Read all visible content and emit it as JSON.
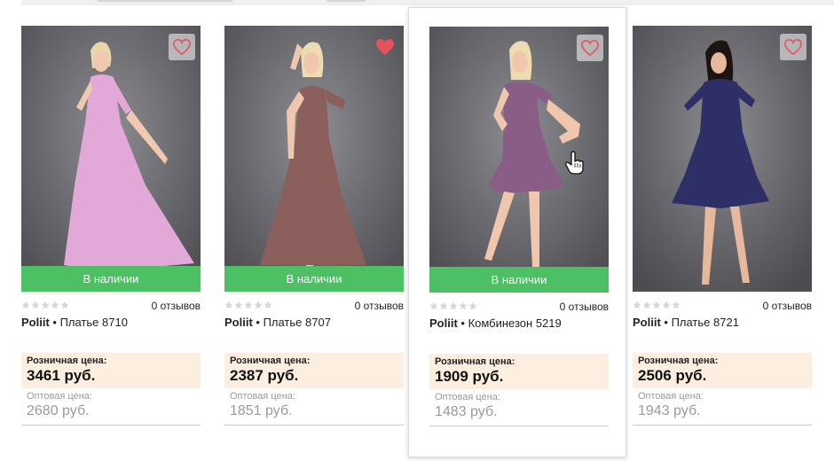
{
  "catalog": {
    "products": [
      {
        "brand": "Poliit",
        "name": "Платье 8710",
        "in_stock": "В наличии",
        "reviews": "0 отзывов",
        "retail_label": "Розничная цена:",
        "retail_price": "3461 руб.",
        "wholesale_label": "Оптовая цена:",
        "wholesale_price": "2680 руб.",
        "favorite": false,
        "dress_color": "#e2a9d8"
      },
      {
        "brand": "Poliit",
        "name": "Платье 8707",
        "in_stock": "В наличии",
        "reviews": "0 отзывов",
        "retail_label": "Розничная цена:",
        "retail_price": "2387 руб.",
        "wholesale_label": "Оптовая цена:",
        "wholesale_price": "1851 руб.",
        "favorite": true,
        "dress_color": "#8a5f5c"
      },
      {
        "brand": "Poliit",
        "name": "Комбинезон 5219",
        "in_stock": "В наличии",
        "reviews": "0 отзывов",
        "retail_label": "Розничная цена:",
        "retail_price": "1909 руб.",
        "wholesale_label": "Оптовая цена:",
        "wholesale_price": "1483 руб.",
        "favorite": false,
        "dress_color": "#8a5d86"
      },
      {
        "brand": "Poliit",
        "name": "Платье 8721",
        "in_stock": "",
        "reviews": "0 отзывов",
        "retail_label": "Розничная цена:",
        "retail_price": "2506 руб.",
        "wholesale_label": "Оптовая цена:",
        "wholesale_price": "1943 руб.",
        "favorite": false,
        "dress_color": "#2d2f66"
      }
    ]
  },
  "colors": {
    "in_stock_green": "#4cc063",
    "heart_red": "#e4535b",
    "retail_bg": "#fcefdf",
    "wholesale_text": "#9a9a9a",
    "photo_bg": "#6e6e72"
  },
  "icons": {
    "favorite": "heart-outline-icon",
    "favorite_active": "heart-filled-icon",
    "rating": "star-icon",
    "cursor": "hand-pointer-icon"
  }
}
